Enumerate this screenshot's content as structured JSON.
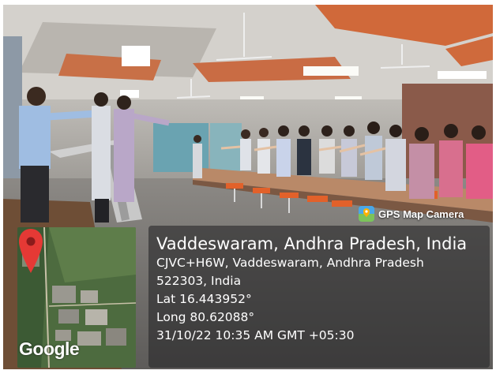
{
  "photo": {
    "subject": "people-standing-pledge-conference-room"
  },
  "badge": {
    "label": "GPS Map Camera",
    "icon": "gps-map-camera-icon"
  },
  "map": {
    "logo_text": "Google",
    "pin_color": "#e53935"
  },
  "location": {
    "title": "Vaddeswaram, Andhra Pradesh, India",
    "address_line1": "CJVC+H6W, Vaddeswaram, Andhra Pradesh",
    "address_line2": "522303, India",
    "latitude": "Lat 16.443952°",
    "longitude": "Long 80.62088°",
    "timestamp": "31/10/22 10:35 AM GMT +05:30"
  },
  "colors": {
    "panel_bg": "#28282a",
    "badge_icon_bg": "#2f8fd8"
  }
}
